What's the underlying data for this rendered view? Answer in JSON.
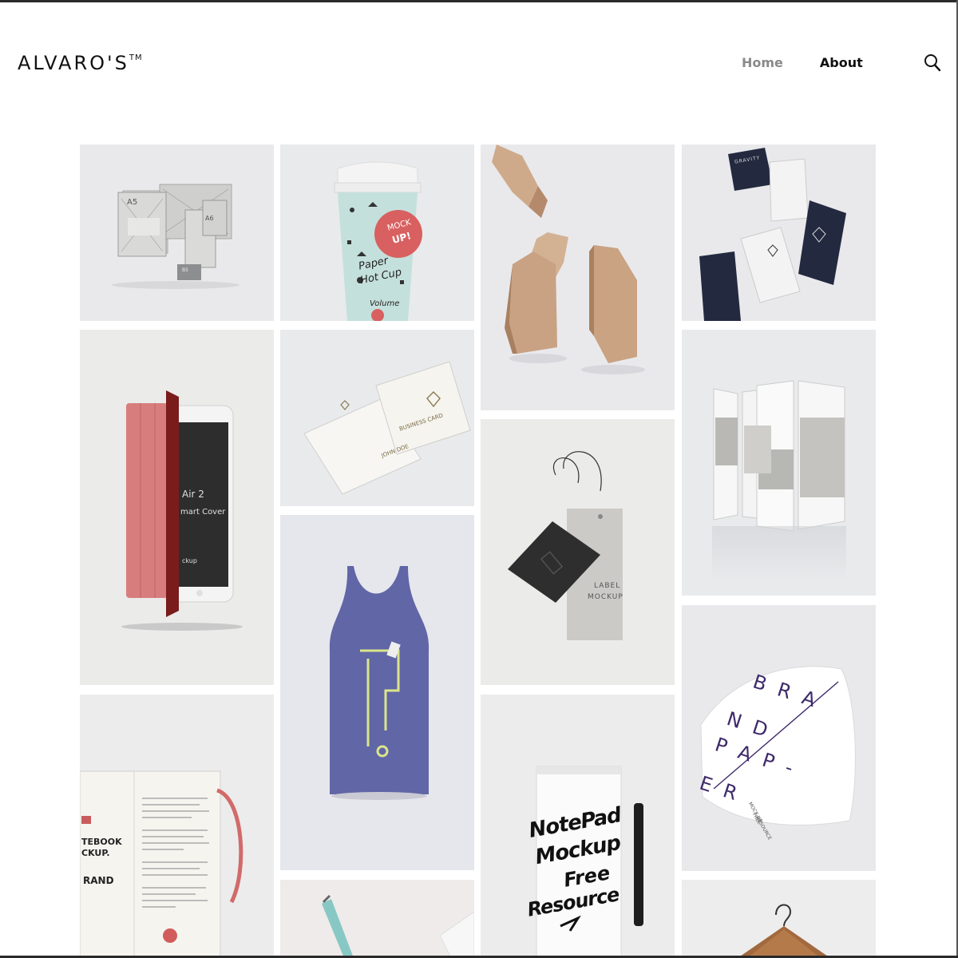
{
  "brand": {
    "name": "ALVARO'S",
    "mark": "TM"
  },
  "nav": {
    "items": [
      "Home",
      "About"
    ],
    "active": "Home"
  },
  "icons": {
    "search": "search-icon"
  },
  "colors": {
    "tile_bg": "#ececec",
    "nav_active": "#8a8a8a",
    "text": "#111111"
  },
  "tiles": {
    "stationery": {
      "a5": "A5",
      "a6": "A6",
      "b5": "B5"
    },
    "cup": {
      "badge_1": "MOCK",
      "badge_2": "UP!",
      "line_1": "Paper",
      "line_2": "Hot Cup",
      "line_3": "Volume"
    },
    "gravity": {
      "brand": "GRAVITY"
    },
    "ipad": {
      "line_1": "Air 2",
      "line_2": "mart Cover",
      "line_3": "ckup"
    },
    "business_card": {
      "title": "BUSINESS CARD",
      "name": "JOHN DOE"
    },
    "label": {
      "line_1": "LABEL",
      "line_2": "MOCKUP"
    },
    "brand_paper": {
      "l1": "B R A",
      "l2": "N D",
      "l3": "P A P -",
      "l4": "E R",
      "sub_1": "MOCK UP",
      "sub_2": "FREE",
      "sub_3": "RESOURCE"
    },
    "notebook": {
      "l1": "TEBOOK",
      "l2": "CKUP.",
      "l3": "RAND"
    },
    "notepad": {
      "l1": "NotePad",
      "l2": "Mockup",
      "l3": "Free",
      "l4": "Resource"
    }
  }
}
